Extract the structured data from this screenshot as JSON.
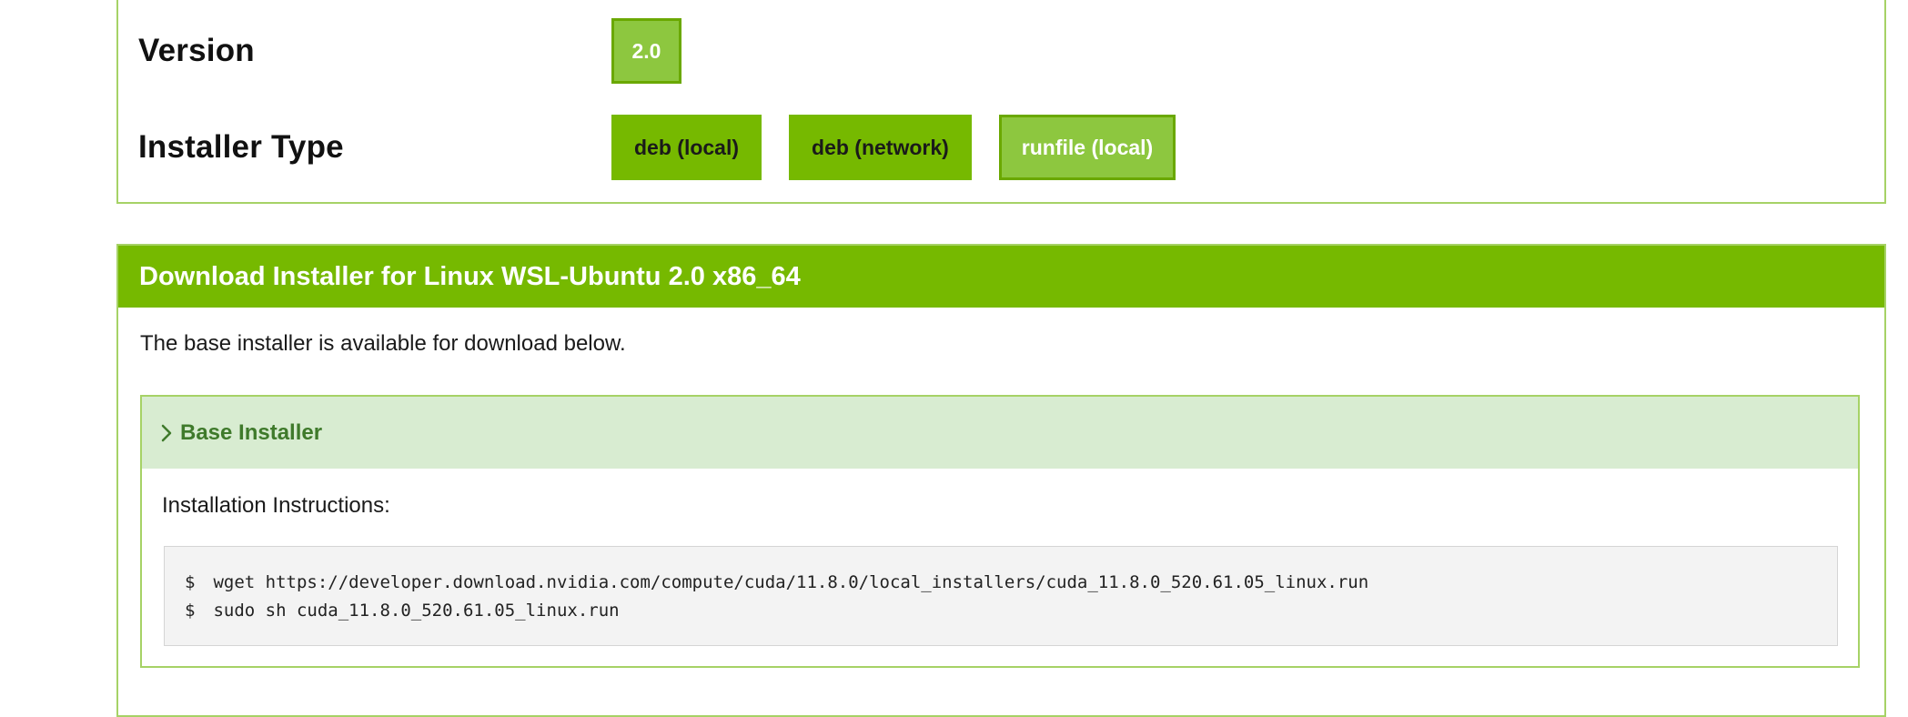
{
  "selection": {
    "version": {
      "label": "Version",
      "options": [
        {
          "label": "2.0",
          "active": true
        }
      ]
    },
    "installer_type": {
      "label": "Installer Type",
      "options": [
        {
          "label": "deb (local)",
          "active": false
        },
        {
          "label": "deb (network)",
          "active": false
        },
        {
          "label": "runfile (local)",
          "active": true
        }
      ]
    }
  },
  "download": {
    "header": "Download Installer for Linux WSL-Ubuntu 2.0 x86_64",
    "note": "The base installer is available for download below.",
    "base_installer": {
      "title": "Base Installer",
      "instructions_label": "Installation Instructions:",
      "commands": [
        {
          "prompt": "$",
          "text": "wget https://developer.download.nvidia.com/compute/cuda/11.8.0/local_installers/cuda_11.8.0_520.61.05_linux.run"
        },
        {
          "prompt": "$",
          "text": "sudo sh cuda_11.8.0_520.61.05_linux.run"
        }
      ]
    }
  },
  "colors": {
    "accent": "#76b900",
    "accent_light": "#8dc73f",
    "panel_border": "#a6d266",
    "installer_head_bg": "#d8ecd1",
    "installer_head_text": "#3f7a2b"
  }
}
